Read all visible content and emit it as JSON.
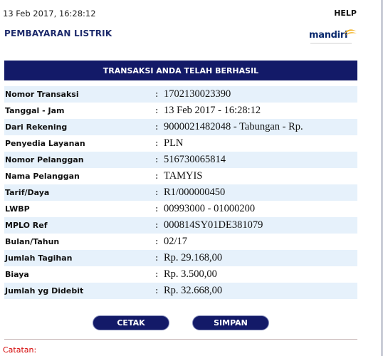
{
  "header": {
    "timestamp": "13 Feb 2017, 16:28:12",
    "help_label": "HELP",
    "page_title": "PEMBAYARAN LISTRIK",
    "logo_text": "mandiri"
  },
  "banner": {
    "text": "TRANSAKSI ANDA TELAH BERHASIL"
  },
  "details": {
    "separator": ":",
    "rows": [
      {
        "label": "Nomor Transaksi",
        "value": "1702130023390"
      },
      {
        "label": "Tanggal - Jam",
        "value": "13 Feb 2017 - 16:28:12"
      },
      {
        "label": "Dari Rekening",
        "value": "9000021482048 - Tabungan - Rp."
      },
      {
        "label": "Penyedia Layanan",
        "value": "PLN"
      },
      {
        "label": "Nomor Pelanggan",
        "value": "516730065814"
      },
      {
        "label": "Nama Pelanggan",
        "value": "TAMYIS"
      },
      {
        "label": "Tarif/Daya",
        "value": "R1/000000450"
      },
      {
        "label": "LWBP",
        "value": "00993000 - 01000200"
      },
      {
        "label": "MPLO Ref",
        "value": "000814SY01DE381079"
      },
      {
        "label": "Bulan/Tahun",
        "value": "02/17"
      },
      {
        "label": "Jumlah Tagihan",
        "value": "Rp. 29.168,00"
      },
      {
        "label": "Biaya",
        "value": "Rp. 3.500,00"
      },
      {
        "label": "Jumlah yg Didebit",
        "value": "Rp. 32.668,00"
      }
    ]
  },
  "actions": {
    "print_label": "CETAK",
    "save_label": "SIMPAN"
  },
  "footer": {
    "note_label": "Catatan:"
  },
  "colors": {
    "banner_bg": "#131a68",
    "row_stripe": "#e6f1fb",
    "title_text": "#1d2a6b",
    "note_text": "#d40000",
    "logo_wave": "#f2b01e"
  }
}
